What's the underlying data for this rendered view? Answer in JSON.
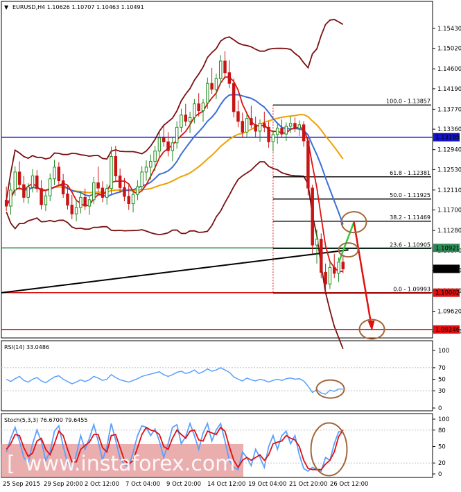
{
  "header": {
    "title": "EURUSD,H4 1.10626 1.10707 1.10463 1.10491"
  },
  "watermark": "www.instaforex.com",
  "rsi_header": "RSI(14) 33.0486",
  "stoch_header": "Stoch(5,3,3) 76.6700 79.6455",
  "colors": {
    "bull": "#1e8c1e",
    "bear": "#c81414",
    "bb": "#7a0f0f",
    "ma_red": "#e01010",
    "ma_blue": "#3a6fd6",
    "ma_orange": "#f0a000",
    "fib": "#000000",
    "rsi": "#5aa0ff",
    "stoch_main": "#5aa0ff",
    "stoch_signal": "#e01010"
  },
  "chart_data": [
    {
      "type": "candlestick",
      "title": "EURUSD,H4 1.10626 1.10707 1.10463 1.10491",
      "ylim": [
        1.091,
        1.157
      ],
      "y_ticks": [
        "1.15430",
        "1.15020",
        "1.14600",
        "1.14190",
        "1.13770",
        "1.13360",
        "1.12940",
        "1.12530",
        "1.12110",
        "1.11700",
        "1.11280",
        "1.10870",
        "1.10460",
        "1.10040",
        "1.09620",
        "1.09210"
      ],
      "x_ticks": [
        "25 Sep 2015",
        "29 Sep 20:00",
        "2 Oct 12:00",
        "7 Oct 04:00",
        "9 Oct 20:00",
        "14 Oct 12:00",
        "19 Oct 04:00",
        "21 Oct 20:00",
        "26 Oct 12:00"
      ],
      "price_tags": [
        {
          "label": "1.13195",
          "value": 1.13195,
          "color": "#1414c8"
        },
        {
          "label": "1.10921",
          "value": 1.10921,
          "color": "#2e8b57"
        },
        {
          "label": "1.10491",
          "value": 1.10491,
          "color": "#000000"
        },
        {
          "label": "1.10002",
          "value": 1.10002,
          "color": "#e01010"
        },
        {
          "label": "1.09246",
          "value": 1.09246,
          "color": "#e01010"
        }
      ],
      "fibonacci": [
        {
          "label": "100.0 - 1.13857",
          "value": 1.13857
        },
        {
          "label": "61.8 - 1.12381",
          "value": 1.12381
        },
        {
          "label": "50.0 - 1.11925",
          "value": 1.11925
        },
        {
          "label": "38.2 - 1.11469",
          "value": 1.11469
        },
        {
          "label": "23.6 - 1.10905",
          "value": 1.10905
        },
        {
          "label": "0.0 - 1.09993",
          "value": 1.09993
        }
      ],
      "ohlc": [
        [
          1.119,
          1.1218,
          1.1168,
          1.1178
        ],
        [
          1.1178,
          1.1226,
          1.116,
          1.1211
        ],
        [
          1.1211,
          1.126,
          1.1199,
          1.1248
        ],
        [
          1.1248,
          1.127,
          1.1212,
          1.1222
        ],
        [
          1.1222,
          1.124,
          1.1185,
          1.1196
        ],
        [
          1.1196,
          1.1225,
          1.1183,
          1.1217
        ],
        [
          1.1217,
          1.1254,
          1.1206,
          1.124
        ],
        [
          1.124,
          1.1252,
          1.1206,
          1.1214
        ],
        [
          1.1214,
          1.1231,
          1.1171,
          1.1181
        ],
        [
          1.1181,
          1.121,
          1.1168,
          1.1199
        ],
        [
          1.1199,
          1.1245,
          1.1188,
          1.1234
        ],
        [
          1.1234,
          1.1273,
          1.1221,
          1.1258
        ],
        [
          1.1258,
          1.1268,
          1.1222,
          1.123
        ],
        [
          1.123,
          1.1244,
          1.1195,
          1.1203
        ],
        [
          1.1203,
          1.1221,
          1.1171,
          1.118
        ],
        [
          1.118,
          1.1201,
          1.1151,
          1.1162
        ],
        [
          1.1162,
          1.119,
          1.1147,
          1.1175
        ],
        [
          1.1175,
          1.1208,
          1.1163,
          1.1196
        ],
        [
          1.1196,
          1.1214,
          1.117,
          1.1178
        ],
        [
          1.1178,
          1.1199,
          1.116,
          1.1191
        ],
        [
          1.1191,
          1.1238,
          1.1182,
          1.1226
        ],
        [
          1.1226,
          1.1259,
          1.1207,
          1.1215
        ],
        [
          1.1215,
          1.1229,
          1.1186,
          1.1196
        ],
        [
          1.1196,
          1.1223,
          1.1181,
          1.1214
        ],
        [
          1.1214,
          1.13,
          1.12,
          1.128
        ],
        [
          1.128,
          1.1302,
          1.1229,
          1.124
        ],
        [
          1.124,
          1.1255,
          1.1205,
          1.1216
        ],
        [
          1.1216,
          1.1236,
          1.1188,
          1.1198
        ],
        [
          1.1198,
          1.1222,
          1.117,
          1.1183
        ],
        [
          1.1183,
          1.1212,
          1.1165,
          1.1202
        ],
        [
          1.1202,
          1.1231,
          1.119,
          1.1218
        ],
        [
          1.1218,
          1.126,
          1.1208,
          1.1248
        ],
        [
          1.1248,
          1.1272,
          1.123,
          1.1258
        ],
        [
          1.1258,
          1.1284,
          1.1232,
          1.127
        ],
        [
          1.127,
          1.1302,
          1.125,
          1.1291
        ],
        [
          1.1291,
          1.133,
          1.1276,
          1.1318
        ],
        [
          1.1318,
          1.1345,
          1.13,
          1.131
        ],
        [
          1.131,
          1.133,
          1.128,
          1.1292
        ],
        [
          1.1292,
          1.1318,
          1.127,
          1.1308
        ],
        [
          1.1308,
          1.1352,
          1.1296,
          1.134
        ],
        [
          1.134,
          1.1378,
          1.133,
          1.1365
        ],
        [
          1.1365,
          1.1388,
          1.1342,
          1.1352
        ],
        [
          1.1352,
          1.1372,
          1.1328,
          1.136
        ],
        [
          1.136,
          1.1398,
          1.1348,
          1.1388
        ],
        [
          1.1388,
          1.141,
          1.1362,
          1.1374
        ],
        [
          1.1374,
          1.1398,
          1.1351,
          1.139
        ],
        [
          1.139,
          1.1442,
          1.1378,
          1.143
        ],
        [
          1.143,
          1.1462,
          1.1408,
          1.1418
        ],
        [
          1.1418,
          1.145,
          1.1398,
          1.144
        ],
        [
          1.144,
          1.1488,
          1.1428,
          1.1476
        ],
        [
          1.1476,
          1.1496,
          1.144,
          1.1452
        ],
        [
          1.1452,
          1.1478,
          1.142,
          1.143
        ],
        [
          1.143,
          1.144,
          1.136,
          1.1372
        ],
        [
          1.1372,
          1.1395,
          1.134,
          1.1352
        ],
        [
          1.1352,
          1.137,
          1.1318,
          1.133
        ],
        [
          1.133,
          1.1368,
          1.1318,
          1.1358
        ],
        [
          1.1358,
          1.1384,
          1.1338,
          1.1345
        ],
        [
          1.1345,
          1.1362,
          1.132,
          1.1332
        ],
        [
          1.1332,
          1.1356,
          1.131,
          1.1348
        ],
        [
          1.1348,
          1.1372,
          1.133,
          1.134
        ],
        [
          1.134,
          1.1352,
          1.1298,
          1.131
        ],
        [
          1.131,
          1.1334,
          1.129,
          1.1325
        ],
        [
          1.1325,
          1.1348,
          1.1306,
          1.1338
        ],
        [
          1.1338,
          1.1356,
          1.1318,
          1.1326
        ],
        [
          1.1326,
          1.135,
          1.1312,
          1.1342
        ],
        [
          1.1342,
          1.1362,
          1.1328,
          1.1348
        ],
        [
          1.1348,
          1.136,
          1.133,
          1.1338
        ],
        [
          1.1338,
          1.1354,
          1.1322,
          1.1345
        ],
        [
          1.1345,
          1.1352,
          1.13,
          1.1312
        ],
        [
          1.1312,
          1.132,
          1.12,
          1.1215
        ],
        [
          1.1215,
          1.1222,
          1.108,
          1.1098
        ],
        [
          1.1098,
          1.113,
          1.106,
          1.111
        ],
        [
          1.111,
          1.1122,
          1.103,
          1.1042
        ],
        [
          1.1042,
          1.106,
          1.1,
          1.1018
        ],
        [
          1.1018,
          1.1065,
          1.1008,
          1.1052
        ],
        [
          1.1052,
          1.108,
          1.103,
          1.104
        ],
        [
          1.104,
          1.1072,
          1.1022,
          1.1063
        ],
        [
          1.1063,
          1.1078,
          1.104,
          1.1049
        ]
      ]
    },
    {
      "type": "line",
      "title": "RSI(14) 33.0486",
      "ylim": [
        0,
        100
      ],
      "y_ticks": [
        "100",
        "70",
        "50",
        "30",
        "0"
      ],
      "series": [
        {
          "name": "RSI(14)",
          "values": [
            50,
            46,
            51,
            55,
            48,
            45,
            50,
            53,
            47,
            44,
            49,
            54,
            56,
            50,
            46,
            42,
            45,
            49,
            46,
            49,
            55,
            52,
            48,
            50,
            58,
            53,
            49,
            47,
            45,
            48,
            51,
            55,
            57,
            59,
            61,
            63,
            58,
            55,
            58,
            62,
            64,
            60,
            62,
            66,
            60,
            63,
            68,
            64,
            66,
            70,
            66,
            62,
            54,
            50,
            47,
            52,
            49,
            47,
            50,
            48,
            45,
            48,
            50,
            48,
            51,
            52,
            50,
            51,
            47,
            38,
            27,
            32,
            26,
            24,
            31,
            29,
            33,
            33
          ]
        }
      ]
    },
    {
      "type": "line",
      "title": "Stoch(5,3,3) 76.6700 79.6455",
      "ylim": [
        0,
        100
      ],
      "y_ticks": [
        "100",
        "80",
        "50",
        "20",
        "0"
      ],
      "series": [
        {
          "name": "Main",
          "values": [
            40,
            65,
            85,
            60,
            30,
            20,
            55,
            80,
            60,
            25,
            40,
            78,
            88,
            50,
            20,
            10,
            35,
            70,
            45,
            65,
            90,
            60,
            25,
            50,
            92,
            62,
            28,
            18,
            12,
            40,
            70,
            88,
            85,
            70,
            82,
            60,
            30,
            55,
            85,
            90,
            55,
            68,
            92,
            70,
            45,
            75,
            92,
            60,
            80,
            92,
            60,
            25,
            12,
            8,
            40,
            30,
            15,
            45,
            30,
            12,
            50,
            70,
            45,
            70,
            78,
            55,
            70,
            35,
            10,
            5,
            12,
            8,
            5,
            30,
            25,
            55,
            77,
            77
          ]
        },
        {
          "name": "Signal",
          "values": [
            45,
            55,
            72,
            70,
            48,
            32,
            38,
            60,
            65,
            45,
            35,
            55,
            78,
            70,
            45,
            22,
            22,
            45,
            52,
            58,
            72,
            72,
            48,
            40,
            70,
            72,
            48,
            25,
            18,
            25,
            48,
            72,
            85,
            80,
            78,
            72,
            50,
            45,
            65,
            80,
            72,
            65,
            78,
            80,
            62,
            60,
            78,
            75,
            72,
            85,
            78,
            50,
            25,
            12,
            25,
            30,
            25,
            30,
            35,
            25,
            35,
            55,
            58,
            60,
            70,
            65,
            62,
            50,
            25,
            10,
            8,
            8,
            8,
            18,
            25,
            40,
            68,
            80
          ]
        }
      ]
    }
  ]
}
